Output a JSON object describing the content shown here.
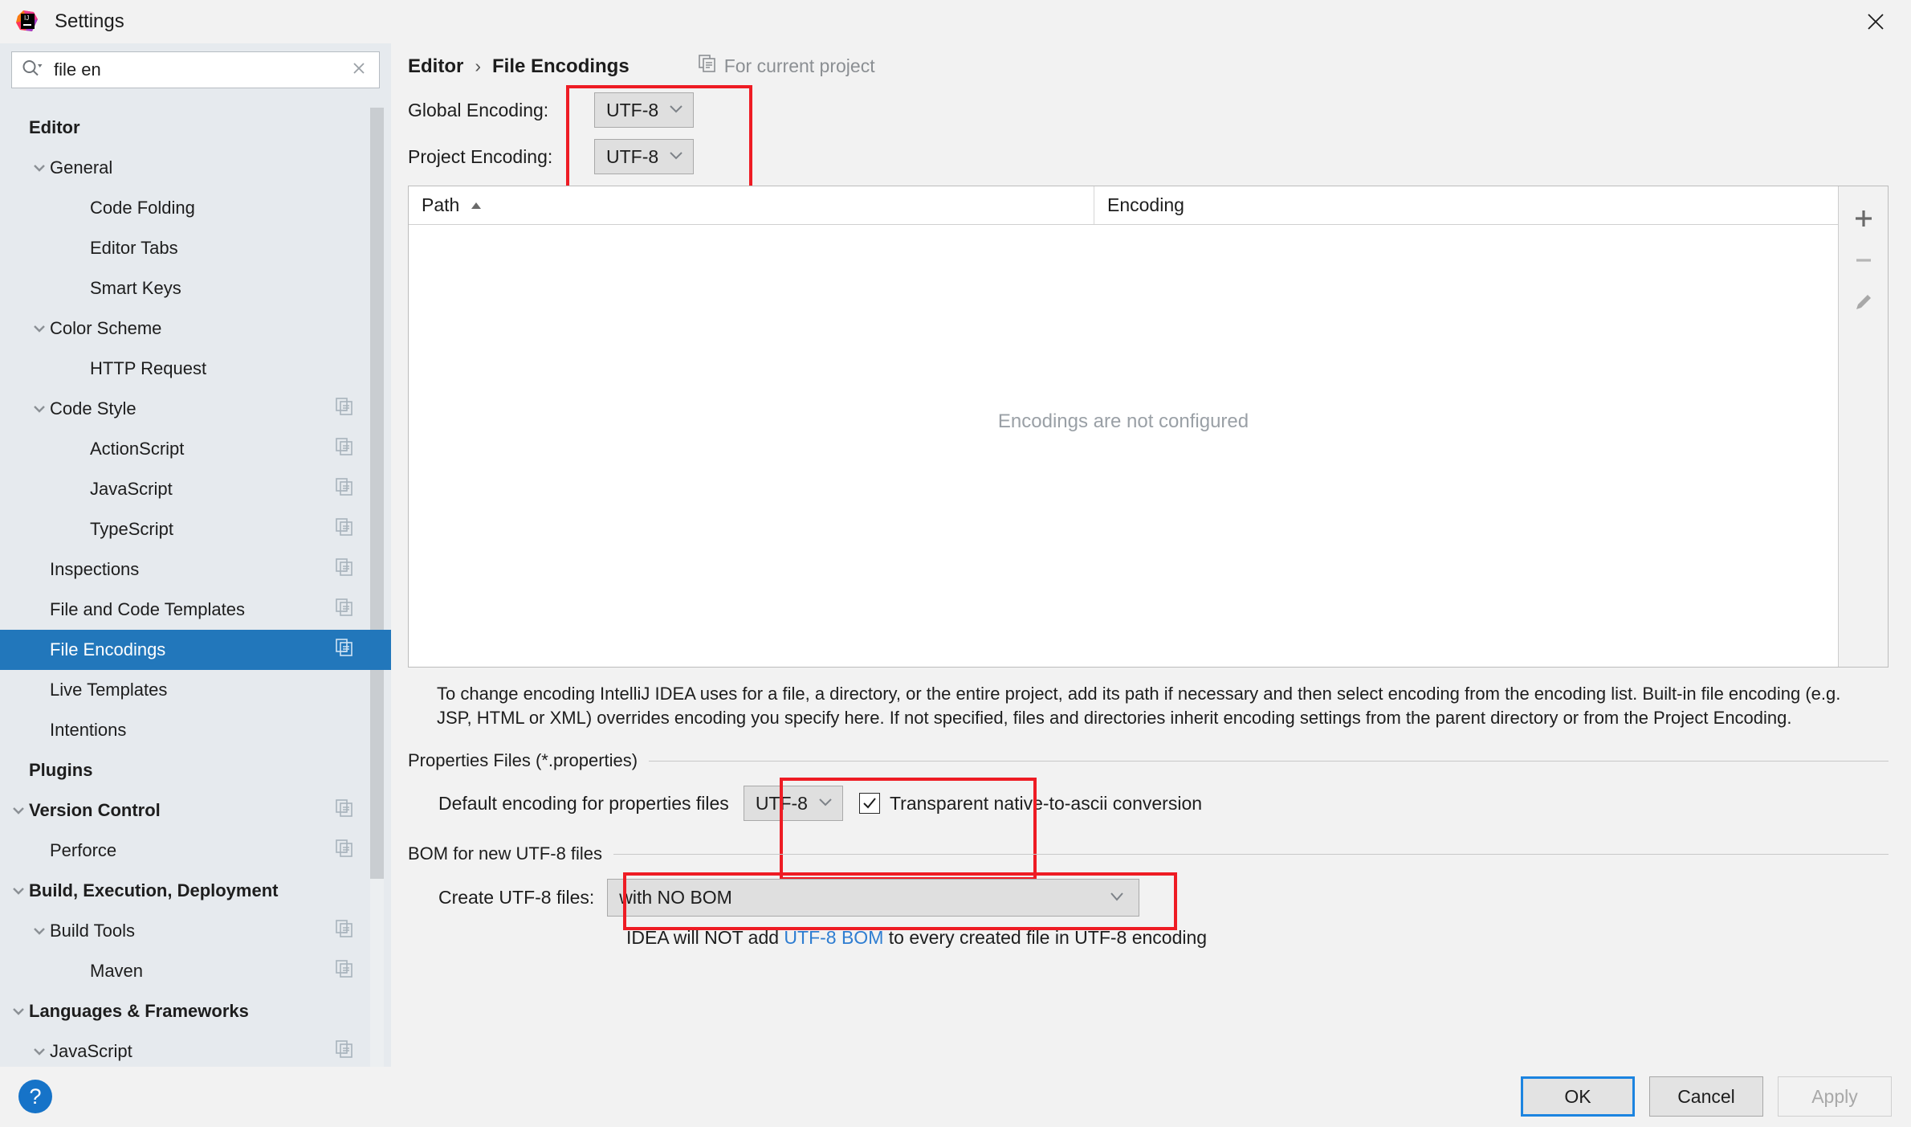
{
  "window": {
    "title": "Settings",
    "app_icon": "intellij-idea-icon",
    "close_icon": "close-icon"
  },
  "search": {
    "value": "file en",
    "placeholder": "",
    "icon": "search-icon",
    "clear_icon": "clear-icon"
  },
  "sidebar": {
    "items": [
      {
        "label": "Editor",
        "indent": 0,
        "bold": true,
        "twisty": "",
        "selected": false,
        "badge": false
      },
      {
        "label": "General",
        "indent": 1,
        "bold": false,
        "twisty": "down",
        "selected": false,
        "badge": false
      },
      {
        "label": "Code Folding",
        "indent": 2,
        "bold": false,
        "twisty": "",
        "selected": false,
        "badge": false
      },
      {
        "label": "Editor Tabs",
        "indent": 2,
        "bold": false,
        "twisty": "",
        "selected": false,
        "badge": false
      },
      {
        "label": "Smart Keys",
        "indent": 2,
        "bold": false,
        "twisty": "",
        "selected": false,
        "badge": false
      },
      {
        "label": "Color Scheme",
        "indent": 1,
        "bold": false,
        "twisty": "down",
        "selected": false,
        "badge": false
      },
      {
        "label": "HTTP Request",
        "indent": 2,
        "bold": false,
        "twisty": "",
        "selected": false,
        "badge": false
      },
      {
        "label": "Code Style",
        "indent": 1,
        "bold": false,
        "twisty": "down",
        "selected": false,
        "badge": true
      },
      {
        "label": "ActionScript",
        "indent": 2,
        "bold": false,
        "twisty": "",
        "selected": false,
        "badge": true
      },
      {
        "label": "JavaScript",
        "indent": 2,
        "bold": false,
        "twisty": "",
        "selected": false,
        "badge": true
      },
      {
        "label": "TypeScript",
        "indent": 2,
        "bold": false,
        "twisty": "",
        "selected": false,
        "badge": true
      },
      {
        "label": "Inspections",
        "indent": 1,
        "bold": false,
        "twisty": "",
        "selected": false,
        "badge": true
      },
      {
        "label": "File and Code Templates",
        "indent": 1,
        "bold": false,
        "twisty": "",
        "selected": false,
        "badge": true
      },
      {
        "label": "File Encodings",
        "indent": 1,
        "bold": false,
        "twisty": "",
        "selected": true,
        "badge": true
      },
      {
        "label": "Live Templates",
        "indent": 1,
        "bold": false,
        "twisty": "",
        "selected": false,
        "badge": false
      },
      {
        "label": "Intentions",
        "indent": 1,
        "bold": false,
        "twisty": "",
        "selected": false,
        "badge": false
      },
      {
        "label": "Plugins",
        "indent": 0,
        "bold": true,
        "twisty": "",
        "selected": false,
        "badge": false
      },
      {
        "label": "Version Control",
        "indent": 0,
        "bold": true,
        "twisty": "down",
        "selected": false,
        "badge": true
      },
      {
        "label": "Perforce",
        "indent": 1,
        "bold": false,
        "twisty": "",
        "selected": false,
        "badge": true
      },
      {
        "label": "Build, Execution, Deployment",
        "indent": 0,
        "bold": true,
        "twisty": "down",
        "selected": false,
        "badge": false
      },
      {
        "label": "Build Tools",
        "indent": 1,
        "bold": false,
        "twisty": "down",
        "selected": false,
        "badge": true
      },
      {
        "label": "Maven",
        "indent": 2,
        "bold": false,
        "twisty": "",
        "selected": false,
        "badge": true
      },
      {
        "label": "Languages & Frameworks",
        "indent": 0,
        "bold": true,
        "twisty": "down",
        "selected": false,
        "badge": false
      },
      {
        "label": "JavaScript",
        "indent": 1,
        "bold": false,
        "twisty": "down",
        "selected": false,
        "badge": true
      }
    ]
  },
  "breadcrumb": {
    "root": "Editor",
    "separator": "›",
    "current": "File Encodings",
    "scope_label": "For current project",
    "scope_icon": "module-icon"
  },
  "encoding": {
    "global_label": "Global Encoding:",
    "global_value": "UTF-8",
    "project_label": "Project Encoding:",
    "project_value": "UTF-8"
  },
  "table": {
    "columns": [
      "Path",
      "Encoding"
    ],
    "sort_column": "Path",
    "sort_direction": "asc",
    "rows": [],
    "empty_message": "Encodings are not configured",
    "tools": [
      {
        "name": "add-row-button",
        "icon": "plus-icon"
      },
      {
        "name": "remove-row-button",
        "icon": "minus-icon"
      },
      {
        "name": "edit-row-button",
        "icon": "pencil-icon"
      }
    ]
  },
  "description": "To change encoding IntelliJ IDEA uses for a file, a directory, or the entire project, add its path if necessary and then select encoding from the encoding list. Built-in file encoding (e.g. JSP, HTML or XML) overrides encoding you specify here. If not specified, files and directories inherit encoding settings from the parent directory or from the Project Encoding.",
  "properties_section": {
    "title": "Properties Files (*.properties)",
    "row_label": "Default encoding for properties files",
    "encoding_value": "UTF-8",
    "checkbox_label": "Transparent native-to-ascii conversion",
    "checkbox_checked": true
  },
  "bom_section": {
    "title": "BOM for new UTF-8 files",
    "row_label": "Create UTF-8 files:",
    "value": "with NO BOM",
    "note_prefix": "IDEA will NOT add ",
    "note_link": "UTF-8 BOM",
    "note_suffix": " to every created file in UTF-8 encoding"
  },
  "footer": {
    "help_label": "?",
    "ok_label": "OK",
    "cancel_label": "Cancel",
    "apply_label": "Apply",
    "apply_enabled": false
  },
  "colors": {
    "accent_blue": "#2277bb",
    "highlight_red": "#ee1c24",
    "link_blue": "#2e7dd1",
    "panel_bg": "#e6eaee",
    "content_bg": "#f2f2f2"
  }
}
